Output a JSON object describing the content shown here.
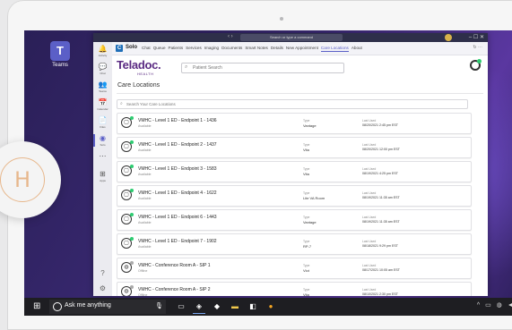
{
  "desktop": {
    "teams_icon_label": "Teams"
  },
  "titlebar": {
    "nav": "‹  ›",
    "search": "Search or type a command",
    "controls": "–  ☐  ✕"
  },
  "rail": [
    {
      "icon": "🔔",
      "label": "Activity"
    },
    {
      "icon": "💬",
      "label": "Chat"
    },
    {
      "icon": "👥",
      "label": "Teams"
    },
    {
      "icon": "📅",
      "label": "Calendar"
    },
    {
      "icon": "📄",
      "label": "Files"
    },
    {
      "icon": "◉",
      "label": "Solo"
    },
    {
      "icon": "⋯",
      "label": ""
    },
    {
      "icon": "⊞",
      "label": "Apps"
    }
  ],
  "rail_bottom": {
    "help": "?",
    "settings": "⚙"
  },
  "app": {
    "name": "Solo",
    "tabs": [
      "Chat",
      "Queue",
      "Patients",
      "Services",
      "Imaging",
      "Documents",
      "Smart Notes",
      "Details",
      "New Appointment",
      "Care Locations",
      "About"
    ],
    "selected_tab": "Care Locations",
    "head_controls": "↻  ⋯"
  },
  "brand": {
    "name": "Teladoc.",
    "sub": "HEALTH"
  },
  "patient_search": {
    "placeholder": "Patient Search"
  },
  "section": {
    "title": "Care Locations"
  },
  "location_search": {
    "placeholder": "Search Your Care Locations"
  },
  "columns": {
    "type": "Type",
    "last_used": "Last Used"
  },
  "locations": [
    {
      "name": "VMHC - Level 1 ED - Endpoint 1 - 1436",
      "status": "Available",
      "type": "Vantage",
      "last_used": "08/20/2021 2:45 pm EST"
    },
    {
      "name": "VMHC - Level 1 ED - Endpoint 2 - 1437",
      "status": "Available",
      "type": "Vita",
      "last_used": "08/20/2021 12:00 pm EST"
    },
    {
      "name": "VMHC - Level 1 ED - Endpoint 3 - 1583",
      "status": "Available",
      "type": "Vita",
      "last_used": "08/19/2021 4:25 pm EST"
    },
    {
      "name": "VMHC - Level 1 ED - Endpoint 4 - 1622",
      "status": "Available",
      "type": "Lite VA Room",
      "last_used": "08/19/2021 11:35 am EST"
    },
    {
      "name": "VMHC - Level 1 ED - Endpoint 6 - 1443",
      "status": "Available",
      "type": "Vantage",
      "last_used": "08/19/2021 11:35 am EST"
    },
    {
      "name": "VMHC - Level 1 ED - Endpoint 7 - 1902",
      "status": "Available",
      "type": "RP-7",
      "last_used": "08/18/2021 9:29 pm EST"
    },
    {
      "name": "VMHC - Conference Room A - SIP 1",
      "status": "Offline",
      "type": "Viot",
      "last_used": "08/17/2021 10:05 am EST"
    },
    {
      "name": "VMHC - Conference Room A - SIP 2",
      "status": "Offline",
      "type": "Vita",
      "last_used": "08/10/2021 2:30 pm EST"
    }
  ],
  "taskbar": {
    "search_text": "Ask me anything"
  }
}
